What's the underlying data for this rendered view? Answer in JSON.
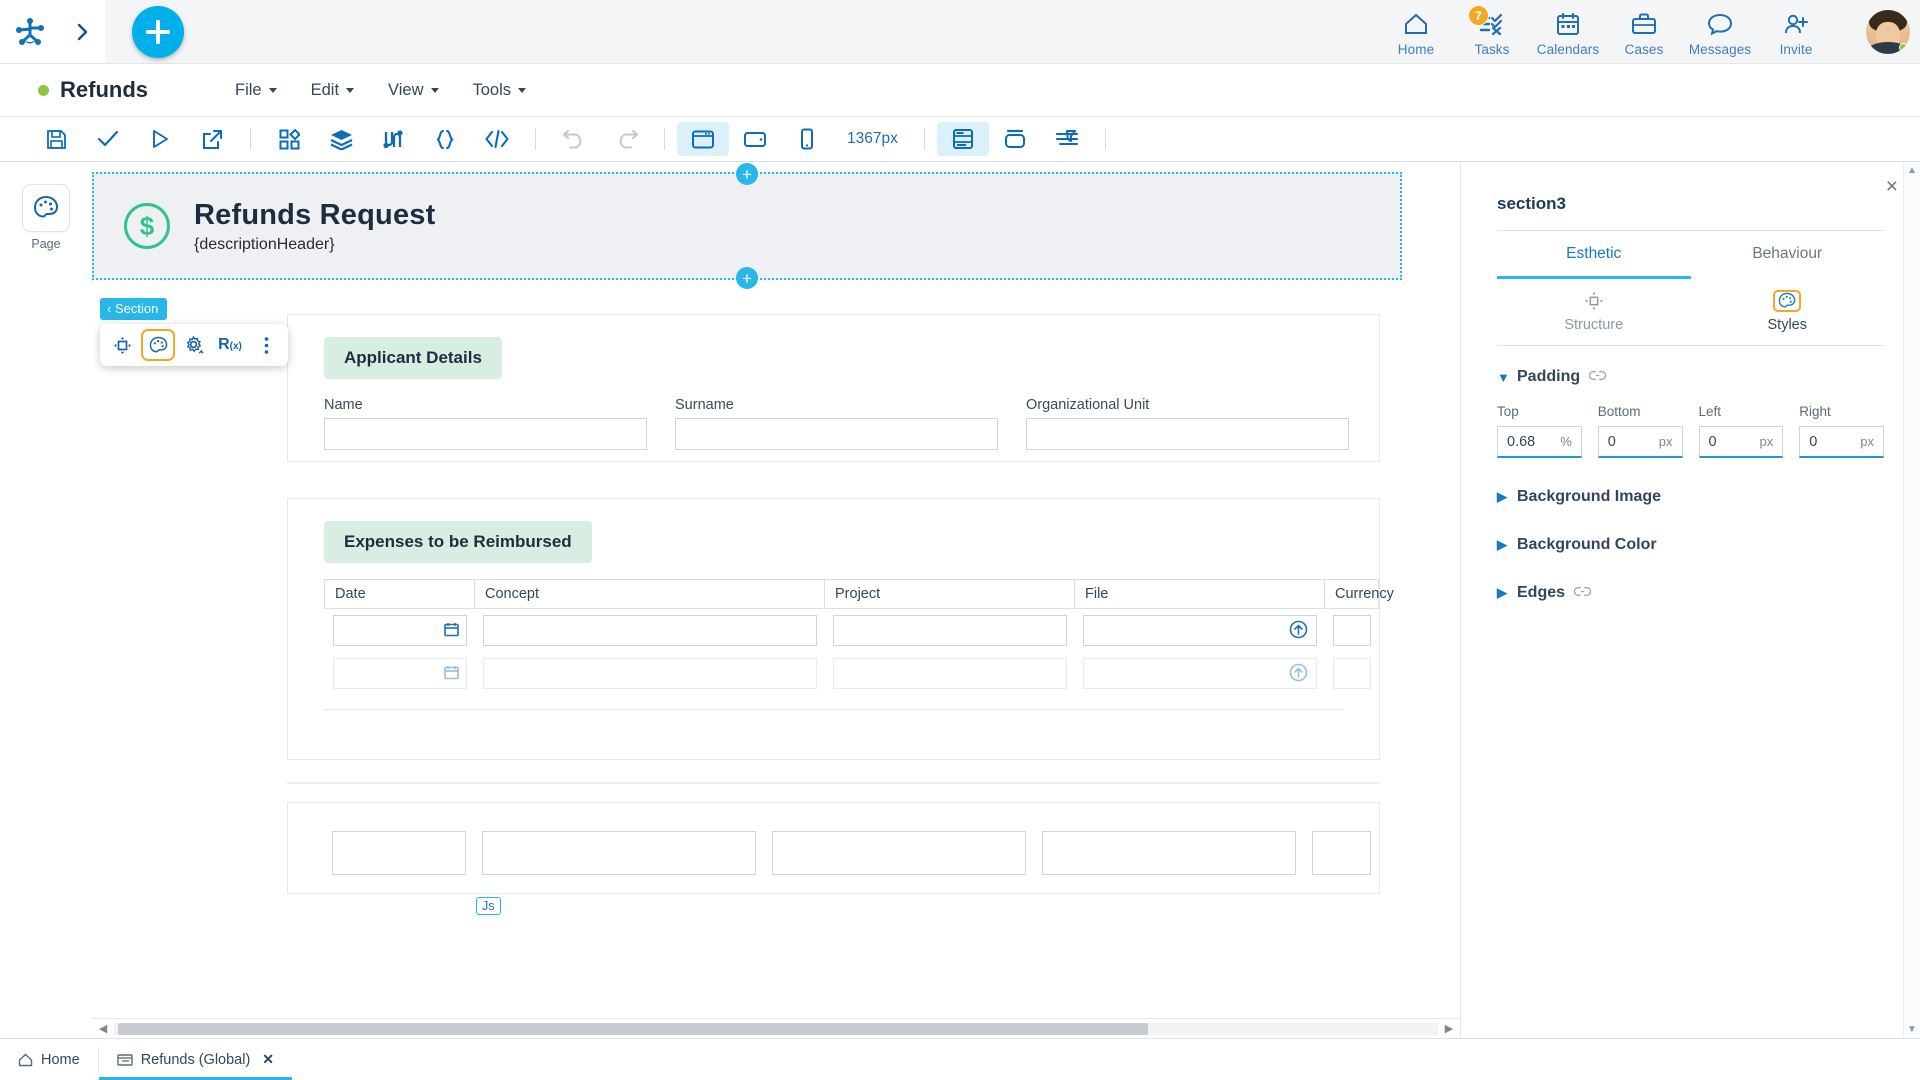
{
  "topbar": {
    "logo_icon": "bonita-logo-icon",
    "expand_icon": "chevron-right-icon",
    "add_label": "+",
    "nav": [
      {
        "label": "Home",
        "icon": "home-icon",
        "badge": ""
      },
      {
        "label": "Tasks",
        "icon": "tasks-checklist-icon",
        "badge": "7"
      },
      {
        "label": "Calendars",
        "icon": "calendar-icon",
        "badge": ""
      },
      {
        "label": "Cases",
        "icon": "cases-briefcase-icon",
        "badge": ""
      },
      {
        "label": "Messages",
        "icon": "messages-chat-icon",
        "badge": ""
      },
      {
        "label": "Invite",
        "icon": "invite-user-icon",
        "badge": ""
      }
    ],
    "avatar_name": "user-avatar"
  },
  "dochead": {
    "title": "Refunds",
    "status_dot_color": "#8ec63f",
    "menus": [
      {
        "label": "File"
      },
      {
        "label": "Edit"
      },
      {
        "label": "View"
      },
      {
        "label": "Tools"
      }
    ]
  },
  "toolbar": {
    "items": [
      {
        "name": "save-icon",
        "state": "normal"
      },
      {
        "name": "validate-check-icon",
        "state": "normal"
      },
      {
        "name": "run-play-icon",
        "state": "normal"
      },
      {
        "name": "export-icon",
        "state": "normal"
      },
      {
        "name": "widgets-grid-icon",
        "state": "normal"
      },
      {
        "name": "layers-icon",
        "state": "normal"
      },
      {
        "name": "variables-icon",
        "state": "normal"
      },
      {
        "name": "json-braces-icon",
        "state": "normal"
      },
      {
        "name": "code-icon",
        "state": "normal"
      },
      {
        "name": "undo-icon",
        "state": "disabled"
      },
      {
        "name": "redo-icon",
        "state": "disabled"
      },
      {
        "name": "desktop-preview-icon",
        "state": "active"
      },
      {
        "name": "tablet-preview-icon",
        "state": "normal"
      },
      {
        "name": "mobile-preview-icon",
        "state": "normal"
      },
      {
        "name": "page-layout-icon",
        "state": "active"
      },
      {
        "name": "container-icon",
        "state": "normal"
      },
      {
        "name": "form-container-icon",
        "state": "normal"
      }
    ],
    "width_label": "1367px"
  },
  "leftrail": {
    "page_icon": "palette-page-icon",
    "page_label": "Page"
  },
  "canvas": {
    "section_badge": "Section",
    "js_tag": "Js",
    "float_tools": [
      {
        "name": "move-icon",
        "selected": false
      },
      {
        "name": "style-palette-icon",
        "selected": true
      },
      {
        "name": "settings-gear-icon",
        "selected": false
      },
      {
        "name": "expression-rx-icon",
        "selected": false
      },
      {
        "name": "more-options-icon",
        "selected": false
      }
    ],
    "header": {
      "icon": "dollar-circle-icon",
      "title": "Refunds Request",
      "subtitle": "{descriptionHeader}"
    },
    "applicant": {
      "chip": "Applicant Details",
      "fields": [
        {
          "label": "Name",
          "value": ""
        },
        {
          "label": "Surname",
          "value": ""
        },
        {
          "label": "Organizational Unit",
          "value": ""
        }
      ]
    },
    "expenses": {
      "chip": "Expenses to be Reimbursed",
      "columns": [
        "Date",
        "Concept",
        "Project",
        "File",
        "Currency"
      ],
      "rows": [
        {
          "date": "",
          "concept": "",
          "project": "",
          "file": "",
          "currency": "",
          "faded": false
        },
        {
          "date": "",
          "concept": "",
          "project": "",
          "file": "",
          "currency": "",
          "faded": true
        }
      ]
    }
  },
  "rpanel": {
    "close_icon": "close-icon",
    "title": "section3",
    "tabs": [
      {
        "label": "Esthetic",
        "active": true
      },
      {
        "label": "Behaviour",
        "active": false
      }
    ],
    "subtabs": [
      {
        "label": "Structure",
        "icon": "structure-move-icon",
        "active": false
      },
      {
        "label": "Styles",
        "icon": "styles-palette-icon",
        "active": true
      }
    ],
    "padding": {
      "section_label": "Padding",
      "link_icon": "link-icon",
      "expanded": true,
      "inputs": [
        {
          "label": "Top",
          "value": "0.68",
          "unit": "%"
        },
        {
          "label": "Bottom",
          "value": "0",
          "unit": "px"
        },
        {
          "label": "Left",
          "value": "0",
          "unit": "px"
        },
        {
          "label": "Right",
          "value": "0",
          "unit": "px"
        }
      ]
    },
    "sections": [
      {
        "label": "Background Image",
        "expanded": false,
        "link": false
      },
      {
        "label": "Background Color",
        "expanded": false,
        "link": false
      },
      {
        "label": "Edges",
        "expanded": false,
        "link": true
      }
    ]
  },
  "bottom": {
    "tabs": [
      {
        "label": "Home",
        "icon": "home-small-icon",
        "closable": false,
        "active": false
      },
      {
        "label": "Refunds (Global)",
        "icon": "page-small-icon",
        "closable": true,
        "active": true
      }
    ]
  },
  "colors": {
    "accent": "#29b6e8",
    "brand_blue": "#1479c9",
    "badge_orange": "#f5a623",
    "status_green": "#8ec63f",
    "chip_green": "#d9eee2"
  }
}
